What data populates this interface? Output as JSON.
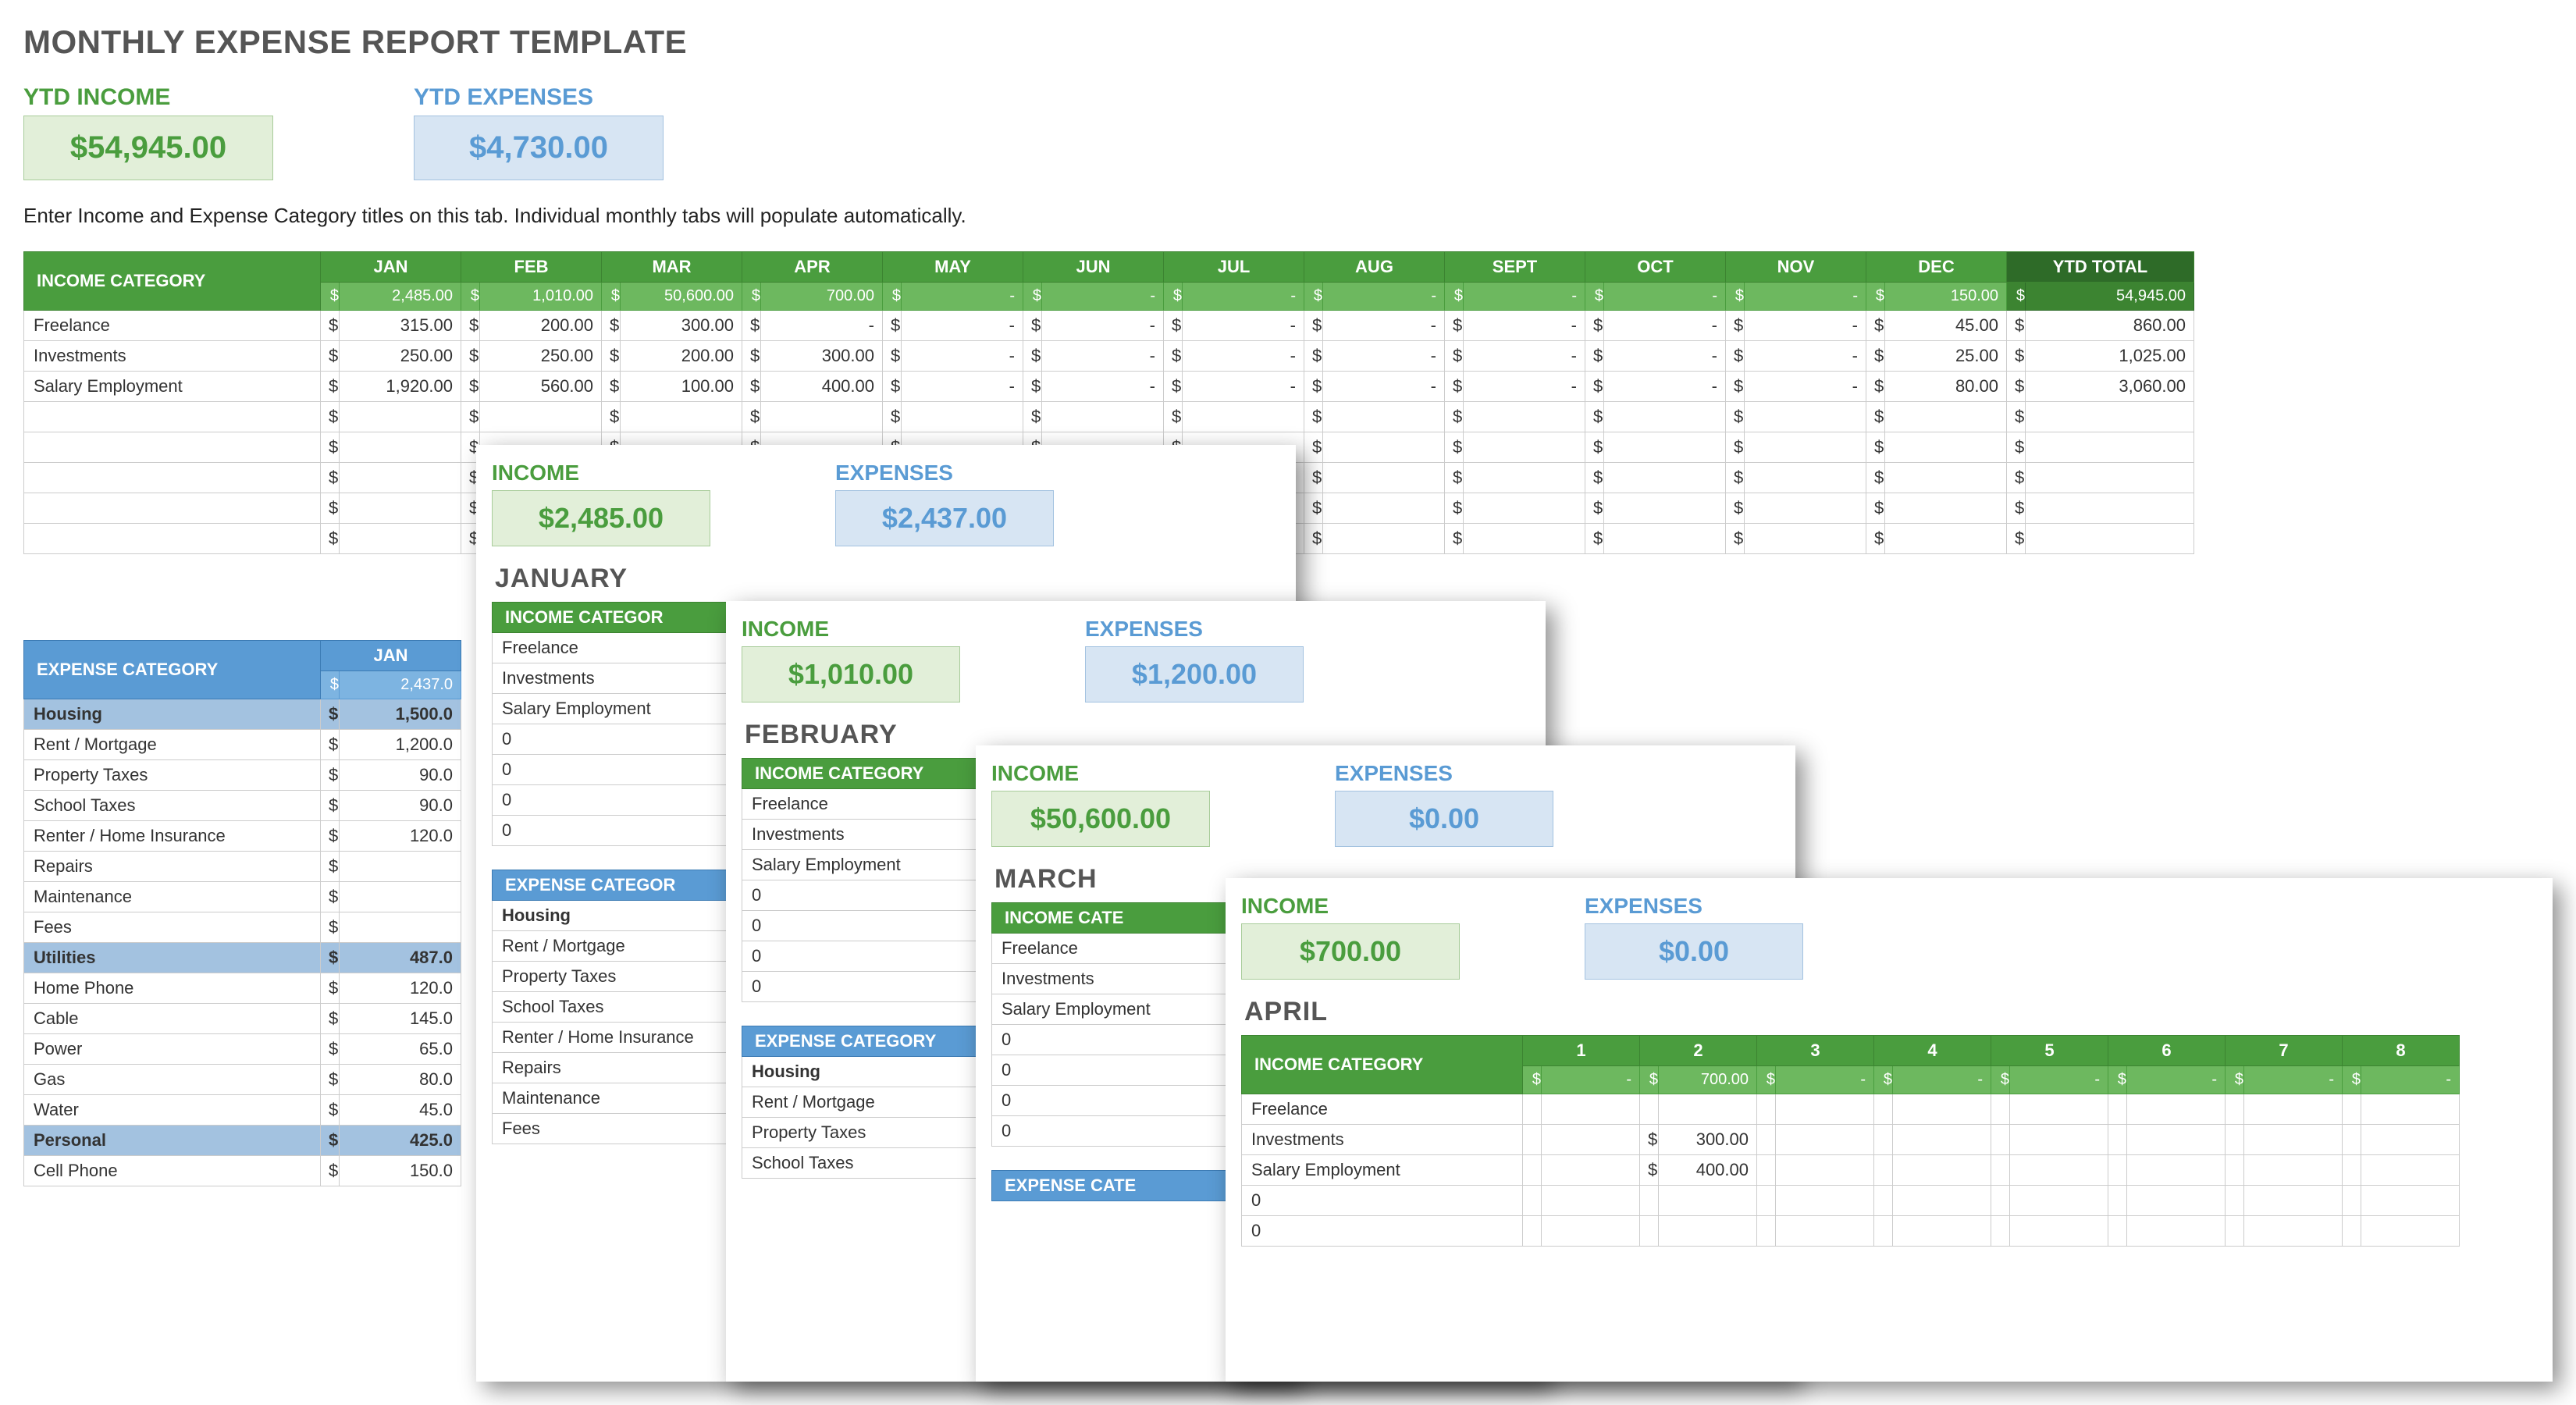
{
  "title": "MONTHLY EXPENSE REPORT TEMPLATE",
  "ytd": {
    "income_label": "YTD INCOME",
    "income_value": "$54,945.00",
    "expenses_label": "YTD EXPENSES",
    "expenses_value": "$4,730.00"
  },
  "instructions": "Enter Income and Expense Category titles on this tab.  Individual monthly tabs will populate automatically.",
  "income_table": {
    "header": "INCOME CATEGORY",
    "months": [
      "JAN",
      "FEB",
      "MAR",
      "APR",
      "MAY",
      "JUN",
      "JUL",
      "AUG",
      "SEPT",
      "OCT",
      "NOV",
      "DEC"
    ],
    "ytd_header": "YTD TOTAL",
    "subrow": [
      "2,485.00",
      "1,010.00",
      "50,600.00",
      "700.00",
      "-",
      "-",
      "-",
      "-",
      "-",
      "-",
      "-",
      "150.00",
      "54,945.00"
    ],
    "rows": [
      {
        "label": "Freelance",
        "vals": [
          "315.00",
          "200.00",
          "300.00",
          "-",
          "-",
          "-",
          "-",
          "-",
          "-",
          "-",
          "-",
          "45.00",
          "860.00"
        ]
      },
      {
        "label": "Investments",
        "vals": [
          "250.00",
          "250.00",
          "200.00",
          "300.00",
          "-",
          "-",
          "-",
          "-",
          "-",
          "-",
          "-",
          "25.00",
          "1,025.00"
        ]
      },
      {
        "label": "Salary Employment",
        "vals": [
          "1,920.00",
          "560.00",
          "100.00",
          "400.00",
          "-",
          "-",
          "-",
          "-",
          "-",
          "-",
          "-",
          "80.00",
          "3,060.00"
        ]
      }
    ]
  },
  "expense_table": {
    "header": "EXPENSE CATEGORY",
    "jan_label": "JAN",
    "jan_total": "2,437.0",
    "rows": [
      {
        "label": "Housing",
        "val": "1,500.0",
        "bold": true
      },
      {
        "label": "Rent / Mortgage",
        "val": "1,200.0"
      },
      {
        "label": "Property Taxes",
        "val": "90.0"
      },
      {
        "label": "School Taxes",
        "val": "90.0"
      },
      {
        "label": "Renter / Home Insurance",
        "val": "120.0"
      },
      {
        "label": "Repairs",
        "val": ""
      },
      {
        "label": "Maintenance",
        "val": ""
      },
      {
        "label": "Fees",
        "val": ""
      },
      {
        "label": "Utilities",
        "val": "487.0",
        "bold": true
      },
      {
        "label": "Home Phone",
        "val": "120.0"
      },
      {
        "label": "Cable",
        "val": "145.0"
      },
      {
        "label": "Power",
        "val": "65.0"
      },
      {
        "label": "Gas",
        "val": "80.0"
      },
      {
        "label": "Water",
        "val": "45.0"
      },
      {
        "label": "Personal",
        "val": "425.0",
        "bold": true
      },
      {
        "label": "Cell Phone",
        "val": "150.0"
      }
    ]
  },
  "panels": {
    "jan": {
      "income_label": "INCOME",
      "income_value": "$2,485.00",
      "expenses_label": "EXPENSES",
      "expenses_value": "$2,437.00",
      "month": "JANUARY",
      "income_cat": "INCOME CATEGOR",
      "cats": [
        "Freelance",
        "Investments",
        "Salary Employment",
        "0",
        "0",
        "0",
        "0"
      ],
      "expense_cat": "EXPENSE CATEGOR",
      "exp_rows": [
        "Housing",
        "Rent / Mortgage",
        "Property Taxes",
        "School Taxes",
        "Renter / Home Insurance",
        "Repairs",
        "Maintenance",
        "Fees"
      ]
    },
    "feb": {
      "income_label": "INCOME",
      "income_value": "$1,010.00",
      "expenses_label": "EXPENSES",
      "expenses_value": "$1,200.00",
      "month": "FEBRUARY",
      "income_cat": "INCOME CATEGORY",
      "cats": [
        "Freelance",
        "Investments",
        "Salary Employment",
        "0",
        "0",
        "0",
        "0"
      ],
      "expense_cat": "EXPENSE CATEGORY",
      "exp_rows": [
        "Housing",
        "Rent / Mortgage",
        "Property Taxes",
        "School Taxes"
      ]
    },
    "mar": {
      "income_label": "INCOME",
      "income_value": "$50,600.00",
      "expenses_label": "EXPENSES",
      "expenses_value": "$0.00",
      "month": "MARCH",
      "income_cat": "INCOME CATE",
      "cats": [
        "Freelance",
        "Investments",
        "Salary Employment",
        "0",
        "0",
        "0",
        "0"
      ],
      "expense_cat": "EXPENSE CATE"
    },
    "apr": {
      "income_label": "INCOME",
      "income_value": "$700.00",
      "expenses_label": "EXPENSES",
      "expenses_value": "$0.00",
      "month": "APRIL",
      "income_cat": "INCOME CATEGORY",
      "day_headers": [
        "1",
        "2",
        "3",
        "4",
        "5",
        "6",
        "7",
        "8"
      ],
      "daysub": [
        "-",
        "700.00",
        "-",
        "-",
        "-",
        "-",
        "-",
        "-"
      ],
      "rows": [
        {
          "label": "Freelance",
          "vals": [
            "",
            "",
            "",
            "",
            "",
            "",
            "",
            ""
          ]
        },
        {
          "label": "Investments",
          "vals": [
            "",
            "300.00",
            "",
            "",
            "",
            "",
            "",
            ""
          ]
        },
        {
          "label": "Salary Employment",
          "vals": [
            "",
            "400.00",
            "",
            "",
            "",
            "",
            "",
            ""
          ]
        },
        {
          "label": "0",
          "vals": [
            "",
            "",
            "",
            "",
            "",
            "",
            "",
            ""
          ]
        },
        {
          "label": "0",
          "vals": [
            "",
            "",
            "",
            "",
            "",
            "",
            "",
            ""
          ]
        }
      ]
    }
  }
}
